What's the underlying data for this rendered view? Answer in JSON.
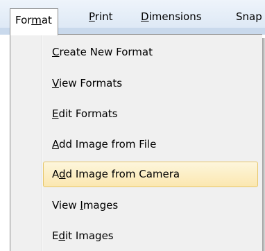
{
  "menubar": {
    "items": [
      {
        "pre": "For",
        "accel": "m",
        "post": "at"
      },
      {
        "pre": "",
        "accel": "P",
        "post": "rint"
      },
      {
        "pre": "",
        "accel": "D",
        "post": "imensions"
      },
      {
        "pre": "Sna",
        "accel": "",
        "post": "p"
      }
    ]
  },
  "dropdown": {
    "items": [
      {
        "pre": "",
        "accel": "C",
        "post": "reate New Format"
      },
      {
        "pre": "",
        "accel": "V",
        "post": "iew Formats"
      },
      {
        "pre": "",
        "accel": "E",
        "post": "dit Formats"
      },
      {
        "pre": "",
        "accel": "A",
        "post": "dd Image from File"
      },
      {
        "pre": "A",
        "accel": "d",
        "post": "d Image from Camera"
      },
      {
        "pre": "View ",
        "accel": "I",
        "post": "mages"
      },
      {
        "pre": "E",
        "accel": "d",
        "post": "it Images"
      }
    ]
  },
  "colors": {
    "highlight_border": "#e6c66a",
    "highlight_fill": "#fbe7b0",
    "menubar_bg": "#dae6f4"
  }
}
